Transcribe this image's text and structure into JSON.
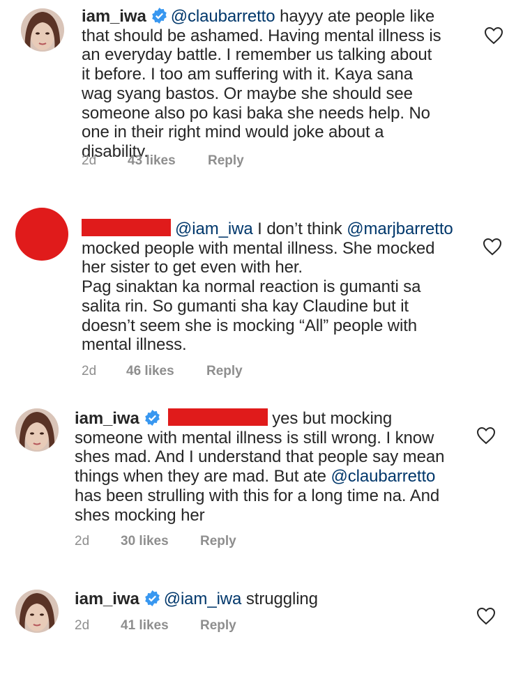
{
  "comments": [
    {
      "username": "iam_iwa",
      "verified": true,
      "mention": "@claubarretto",
      "text": " hayyy ate people like that should be ashamed. Having mental illness is an everyday battle. I remember us talking about it before. I too am suffering with it. Kaya sana wag syang bastos. Or maybe she should see someone also po kasi baka she needs help. No one in their right mind would joke about a disability.",
      "time": "2d",
      "likes": "43 likes",
      "reply": "Reply"
    },
    {
      "username": "",
      "redacted": true,
      "mention": "@iam_iwa",
      "text_a": " I don’t think ",
      "mention2": "@marjbarretto",
      "text_b": " mocked people with mental illness. She mocked her sister to get even with her.",
      "text_c": "Pag sinaktan ka normal reaction is gumanti sa salita rin. So gumanti sha kay Claudine but it doesn’t seem she is mocking “All” people with mental illness.",
      "time": "2d",
      "likes": "46 likes",
      "reply": "Reply"
    },
    {
      "username": "iam_iwa",
      "verified": true,
      "text_a": " yes but mocking someone with mental illness is still wrong. I know shes mad. And I understand that people say mean things when they are mad. But ate ",
      "mention": "@claubarretto",
      "text_b": " has been strulling with this for a long time na. And shes mocking her",
      "time": "2d",
      "likes": "30 likes",
      "reply": "Reply"
    },
    {
      "username": "iam_iwa",
      "verified": true,
      "mention": "@iam_iwa",
      "text": " struggling",
      "time": "2d",
      "likes": "41 likes",
      "reply": "Reply"
    }
  ],
  "colors": {
    "text": "#262626",
    "mention": "#00376b",
    "meta": "#8e8e8e",
    "verified": "#3897f0",
    "redaction": "#e01b1b"
  },
  "icons": {
    "like": "heart-outline-icon",
    "verified": "verified-badge-icon"
  }
}
